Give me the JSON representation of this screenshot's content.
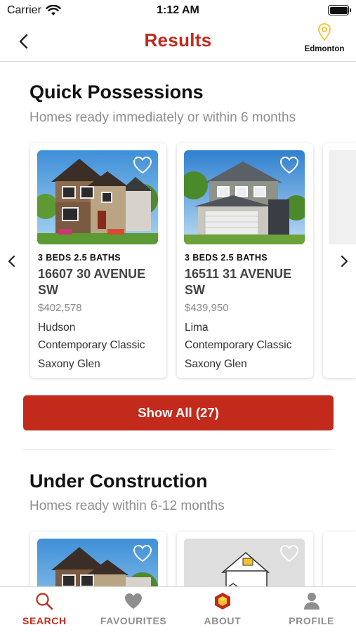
{
  "status_bar": {
    "carrier": "Carrier",
    "time": "1:12 AM"
  },
  "nav": {
    "title": "Results",
    "location": "Edmonton"
  },
  "colors": {
    "accent": "#c22a1c",
    "location_pin": "#f2c230",
    "muted_text": "#8e8e8e"
  },
  "sections": [
    {
      "title": "Quick Possessions",
      "subtitle": "Homes ready immediately or within 6 months",
      "show_all_label": "Show All (27)",
      "cards": [
        {
          "beds_baths": "3 BEDS 2.5 BATHS",
          "address": "16607 30 AVENUE SW",
          "price": "$402,578",
          "model": "Hudson",
          "style": "Contemporary Classic",
          "community": "Saxony Glen",
          "image": "house-photo-brown"
        },
        {
          "beds_baths": "3 BEDS 2.5 BATHS",
          "address": "16511 31 AVENUE SW",
          "price": "$439,950",
          "model": "Lima",
          "style": "Contemporary Classic",
          "community": "Saxony Glen",
          "image": "house-photo-grey"
        }
      ]
    },
    {
      "title": "Under Construction",
      "subtitle": "Homes ready within 6-12 months",
      "cards": [
        {
          "image": "house-photo-brown"
        },
        {
          "image": "house-placeholder-sketch"
        }
      ]
    }
  ],
  "tabs": [
    {
      "label": "SEARCH",
      "icon": "search-icon",
      "active": true
    },
    {
      "label": "FAVOURITES",
      "icon": "heart-icon",
      "active": false
    },
    {
      "label": "ABOUT",
      "icon": "cube-logo-icon",
      "active": false
    },
    {
      "label": "PROFILE",
      "icon": "person-icon",
      "active": false
    }
  ]
}
